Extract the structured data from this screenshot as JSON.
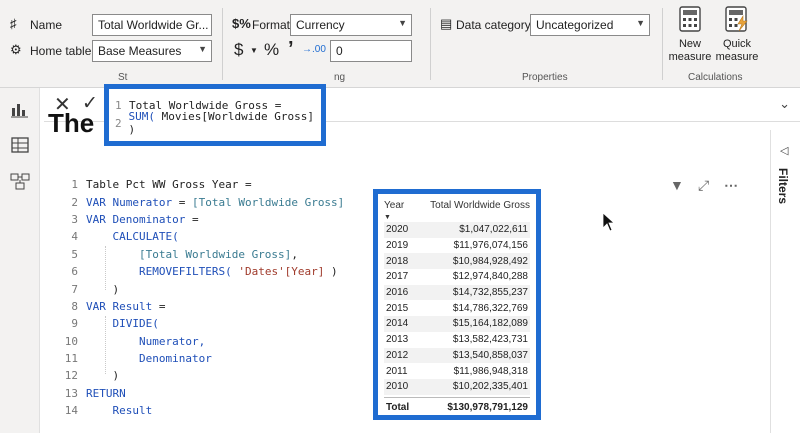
{
  "ribbon": {
    "name_label": "Name",
    "name_value": "Total Worldwide Gr...",
    "home_table_label": "Home table",
    "home_table_value": "Base Measures",
    "structure_group": "St",
    "format_label": "Format",
    "format_value": "Currency",
    "currency_symbol": "$",
    "percent_symbol": "%",
    "comma_symbol": "’",
    "decimal_symbol": "→.00",
    "decimal_value": "0",
    "formatting_group": "ng",
    "data_category_label": "Data category",
    "data_category_value": "Uncategorized",
    "properties_group": "Properties",
    "new_measure_label": "New measure",
    "quick_measure_label": "Quick measure",
    "calculations_group": "Calculations"
  },
  "formula": {
    "lines": [
      {
        "num": "1",
        "text": "Total Worldwide Gross ="
      },
      {
        "num": "2",
        "fn": "SUM(",
        "rest": " Movies[Worldwide Gross] )"
      }
    ]
  },
  "canvas_title": "The",
  "measure_code": [
    {
      "num": "1",
      "parts": [
        {
          "t": "Table Pct WW Gross Year =",
          "c": ""
        }
      ]
    },
    {
      "num": "2",
      "parts": [
        {
          "t": "VAR ",
          "c": "kw"
        },
        {
          "t": "Numerator",
          "c": "kw"
        },
        {
          "t": " = ",
          "c": ""
        },
        {
          "t": "[Total Worldwide Gross]",
          "c": "ms"
        }
      ]
    },
    {
      "num": "3",
      "parts": [
        {
          "t": "VAR ",
          "c": "kw"
        },
        {
          "t": "Denominator",
          "c": "kw"
        },
        {
          "t": " =",
          "c": ""
        }
      ]
    },
    {
      "num": "4",
      "parts": [
        {
          "t": "    CALCULATE(",
          "c": "fn"
        }
      ]
    },
    {
      "num": "5",
      "parts": [
        {
          "t": "        [Total Worldwide Gross]",
          "c": "ms"
        },
        {
          "t": ",",
          "c": ""
        }
      ]
    },
    {
      "num": "6",
      "parts": [
        {
          "t": "        REMOVEFILTERS(",
          "c": "fn"
        },
        {
          "t": " ",
          "c": ""
        },
        {
          "t": "'Dates'[Year]",
          "c": "str"
        },
        {
          "t": " )",
          "c": ""
        }
      ]
    },
    {
      "num": "7",
      "parts": [
        {
          "t": "    )",
          "c": ""
        }
      ]
    },
    {
      "num": "8",
      "parts": [
        {
          "t": "VAR ",
          "c": "kw"
        },
        {
          "t": "Result",
          "c": "kw"
        },
        {
          "t": " =",
          "c": ""
        }
      ]
    },
    {
      "num": "9",
      "parts": [
        {
          "t": "    DIVIDE(",
          "c": "fn"
        }
      ]
    },
    {
      "num": "10",
      "parts": [
        {
          "t": "        Numerator,",
          "c": "kw"
        }
      ]
    },
    {
      "num": "11",
      "parts": [
        {
          "t": "        Denominator",
          "c": "kw"
        }
      ]
    },
    {
      "num": "12",
      "parts": [
        {
          "t": "    )",
          "c": ""
        }
      ]
    },
    {
      "num": "13",
      "parts": [
        {
          "t": "RETURN",
          "c": "kw"
        }
      ]
    },
    {
      "num": "14",
      "parts": [
        {
          "t": "    Result",
          "c": "kw"
        }
      ]
    }
  ],
  "table": {
    "col_year": "Year",
    "col_gross": "Total Worldwide Gross",
    "rows": [
      {
        "year": "2020",
        "gross": "$1,047,022,611"
      },
      {
        "year": "2019",
        "gross": "$11,976,074,156"
      },
      {
        "year": "2018",
        "gross": "$10,984,928,492"
      },
      {
        "year": "2017",
        "gross": "$12,974,840,288"
      },
      {
        "year": "2016",
        "gross": "$14,732,855,237"
      },
      {
        "year": "2015",
        "gross": "$14,786,322,769"
      },
      {
        "year": "2014",
        "gross": "$15,164,182,089"
      },
      {
        "year": "2013",
        "gross": "$13,582,423,731"
      },
      {
        "year": "2012",
        "gross": "$13,540,858,037"
      },
      {
        "year": "2011",
        "gross": "$11,986,948,318"
      },
      {
        "year": "2010",
        "gross": "$10,202,335,401"
      }
    ],
    "total_label": "Total",
    "total_value": "$130,978,791,129"
  },
  "filters_label": "Filters",
  "colors": {
    "accent": "#1f6cd1"
  }
}
